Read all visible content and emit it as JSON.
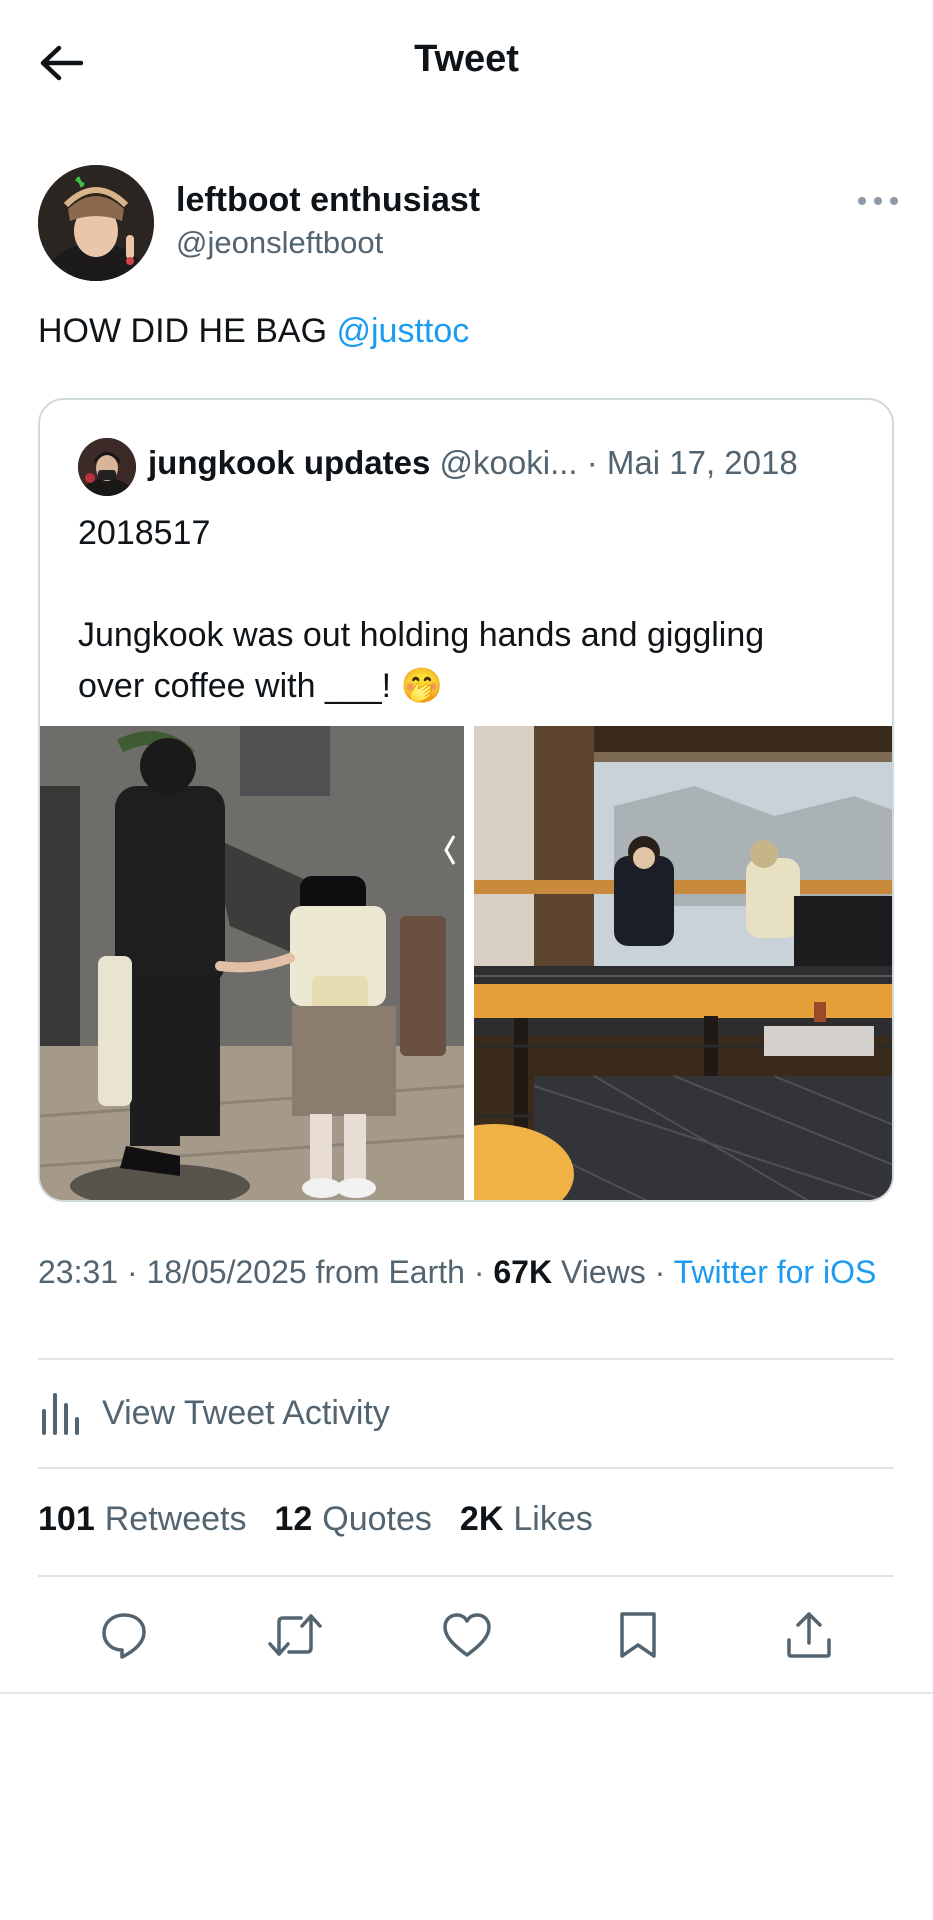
{
  "header": {
    "title": "Tweet",
    "back_icon": "arrow-left-icon"
  },
  "tweet": {
    "author": {
      "name": "leftboot enthusiast",
      "handle": "@jeonsleftboot"
    },
    "text": "HOW DID HE BAG ",
    "mention": "@justtoc"
  },
  "quote": {
    "name": "jungkook updates",
    "handle": "@kooki...",
    "sep": " · ",
    "date": "Mai 17, 2018",
    "line1": "2018517",
    "line2": "Jungkook was out holding hands and giggling",
    "line3": "over coffee with ___! 🤭"
  },
  "meta": {
    "time": "23:31 · 18/05/2025 from Earth · ",
    "views_count": "67K",
    "views_label": " Views · ",
    "source": "Twitter for iOS"
  },
  "activity": {
    "label": "View Tweet Activity",
    "icon": "bar-chart-icon"
  },
  "stats": [
    {
      "count": "101",
      "label": "Retweets"
    },
    {
      "count": "12",
      "label": "Quotes"
    },
    {
      "count": "2K",
      "label": "Likes"
    }
  ],
  "actions": [
    "reply-icon",
    "retweet-icon",
    "like-icon",
    "bookmark-icon",
    "share-icon"
  ],
  "colors": {
    "accent": "#1d9bf0",
    "text": "#0f1419",
    "secondary": "#536471",
    "divider": "#e1e5e8"
  }
}
